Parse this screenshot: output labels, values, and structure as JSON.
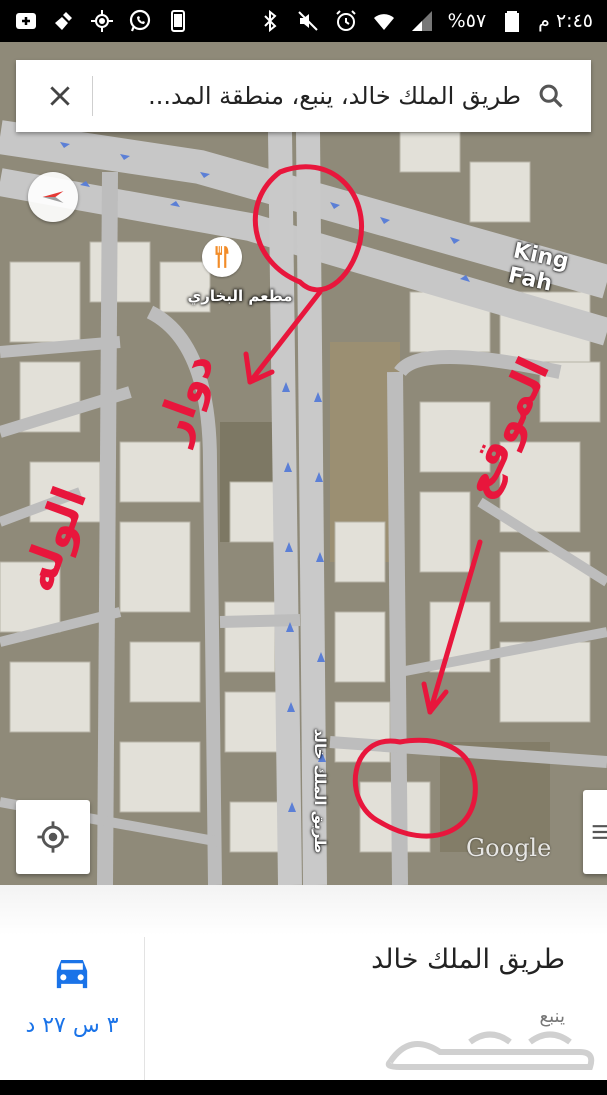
{
  "status_bar": {
    "time": "٢:٤٥ م",
    "battery": "٥٧%",
    "icons_left": [
      "plus-icon",
      "cleaner-icon",
      "gps-icon",
      "whatsapp-icon",
      "phone-icon"
    ],
    "icons_right": [
      "bluetooth-icon",
      "mute-icon",
      "alarm-icon",
      "wifi-icon",
      "signal-icon",
      "battery-icon"
    ]
  },
  "search": {
    "query": "طريق الملك خالد، ينبع، منطقة المد..."
  },
  "map": {
    "poi_name": "مطعم البخاري",
    "road_label_vertical": "طريق الملك خالد",
    "road_label_horizontal": "King Fah",
    "annotations": [
      "دوار",
      "الوله",
      "الموقع"
    ],
    "google_logo": "Google",
    "colors": {
      "road": "#c9c9c9",
      "roof": "#e4e2dc",
      "ground": "#8f8a79",
      "annotation": "#e8163c",
      "arrow": "#5b7fd6"
    }
  },
  "bottom_sheet": {
    "title": "طريق الملك خالد",
    "subtitle": "ينبع",
    "eta": "٣ س ٢٧ د",
    "watermark": "حراج",
    "accent": "#1a73e8"
  }
}
